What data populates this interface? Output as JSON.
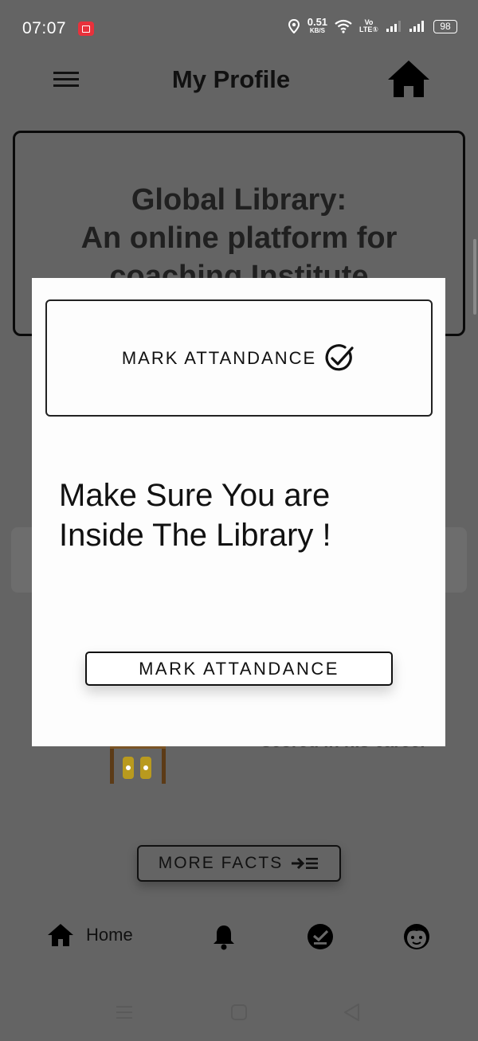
{
  "status_bar": {
    "time": "07:07",
    "net_speed_value": "0.51",
    "net_speed_unit": "KB/S",
    "volte_label_top": "Vo",
    "volte_label_bottom": "LTE①",
    "battery_level": "98"
  },
  "header": {
    "title": "My Profile",
    "menu_icon": "hamburger-menu-icon",
    "home_icon": "home-icon"
  },
  "banner": {
    "line1": "Global Library:",
    "line2": "An online platform for",
    "line3": "coaching Institute"
  },
  "fact": {
    "text": "scored in his career"
  },
  "more_facts": {
    "label": "MORE FACTS",
    "icon": "arrow-list-icon"
  },
  "bottom_nav": {
    "home_label": "Home",
    "items": [
      "home-icon",
      "bell-icon",
      "check-circle-icon",
      "face-icon"
    ]
  },
  "modal": {
    "header_title": "MARK ATTANDANCE",
    "header_icon": "check-circle-outline-icon",
    "message_line1": "Make Sure You are",
    "message_line2": "Inside The Library !",
    "button_label": "MARK ATTANDANCE"
  },
  "colors": {
    "overlay": "#646464",
    "modal_bg": "#fdfdfd",
    "text": "#111111",
    "record_badge": "#e8313b"
  }
}
